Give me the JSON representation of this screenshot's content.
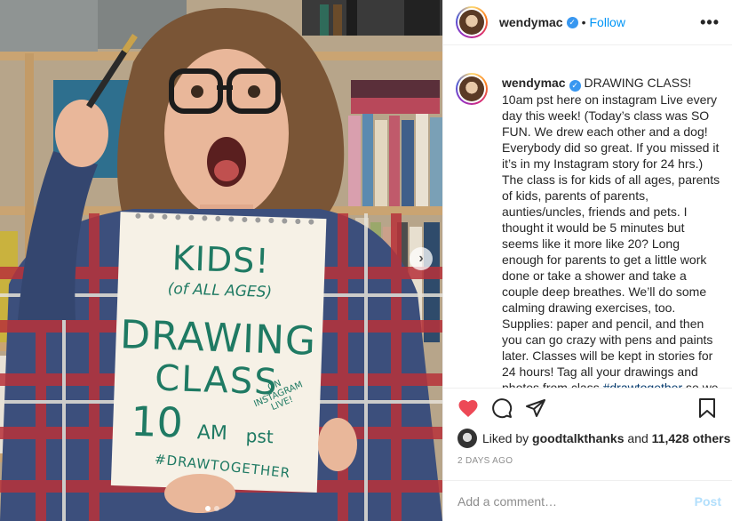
{
  "post": {
    "username": "wendymac",
    "verified": true,
    "separator": "•",
    "follow_label": "Follow",
    "more_icon": "•••",
    "caption_text": "DRAWING CLASS! 10am pst here on instagram Live every day this week! (Today’s class was SO FUN. We drew each other and a dog! Everybody did so great. If you missed it it’s in my Instagram story for 24 hrs.) The class is for kids of all ages, parents of kids, parents of parents, aunties/uncles, friends and pets. I thought it would be 5 minutes but seems like it more like 20? Long enough for parents to get a little work done or take a shower and take a couple deep breathes. We’ll do some calming drawing exercises, too. Supplies: paper and pencil, and then you can go crazy with pens and paints later. Classes will be kept in stories for 24 hours! Tag all your drawings and photos from class",
    "hashtag": "#drawtogether",
    "caption_tail": "so we can",
    "likes_prefix": "Liked by",
    "liked_by_user": "goodtalkthanks",
    "likes_and": "and",
    "likes_count": "11,428 others",
    "timestamp": "2 DAYS AGO",
    "comment_placeholder": "Add a comment…",
    "post_label": "Post",
    "liked": true
  },
  "photo": {
    "sign_lines": [
      "KIDS!",
      "(of ALL AGES)",
      "DRAWING",
      "CLASS",
      "10",
      "AM",
      "pst",
      "ON INSTAGRAM LIVE!",
      "#DRAWTOGETHER"
    ],
    "carousel_next_icon": "›",
    "slide_count": 2,
    "active_slide": 1
  },
  "colors": {
    "accent_blue": "#0095f6",
    "verified_blue": "#3897f0",
    "like_red": "#ed4956",
    "sign_ink": "#1f7a63",
    "muted_text": "#8e8e8e"
  },
  "icons": [
    "verified-badge-icon",
    "more-options-icon",
    "heart-icon",
    "comment-icon",
    "share-icon",
    "bookmark-icon",
    "chevron-right-icon"
  ]
}
